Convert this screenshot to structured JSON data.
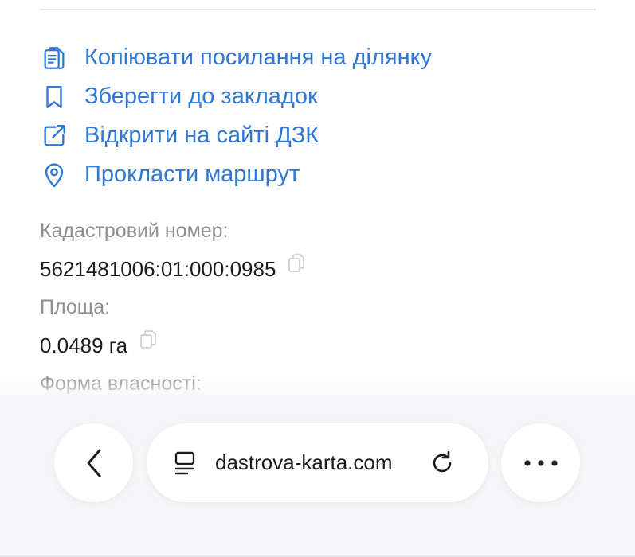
{
  "actions": [
    {
      "label": "Копіювати посилання на ділянку",
      "icon": "clipboard-icon"
    },
    {
      "label": "Зберегти до закладок",
      "icon": "bookmark-icon"
    },
    {
      "label": "Відкрити на сайті ДЗК",
      "icon": "external-link-icon"
    },
    {
      "label": "Прокласти маршрут",
      "icon": "location-pin-icon"
    }
  ],
  "info": {
    "cadastral_caption": "Кадастровий номер:",
    "cadastral_value": "5621481006:01:000:0985",
    "area_caption": "Площа:",
    "area_value": "0.0489 га",
    "ownership_caption": "Форма власності:"
  },
  "browser": {
    "url": "dastrova-karta.com",
    "back_icon": "chevron-left-icon",
    "reader_icon": "reader-mode-icon",
    "reload_icon": "reload-icon",
    "more_icon": "more-icon"
  },
  "colors": {
    "link": "#3178d6",
    "caption": "#8e8e93",
    "text": "#1c1c1e",
    "toolbar_bg": "#f6f6f8"
  }
}
